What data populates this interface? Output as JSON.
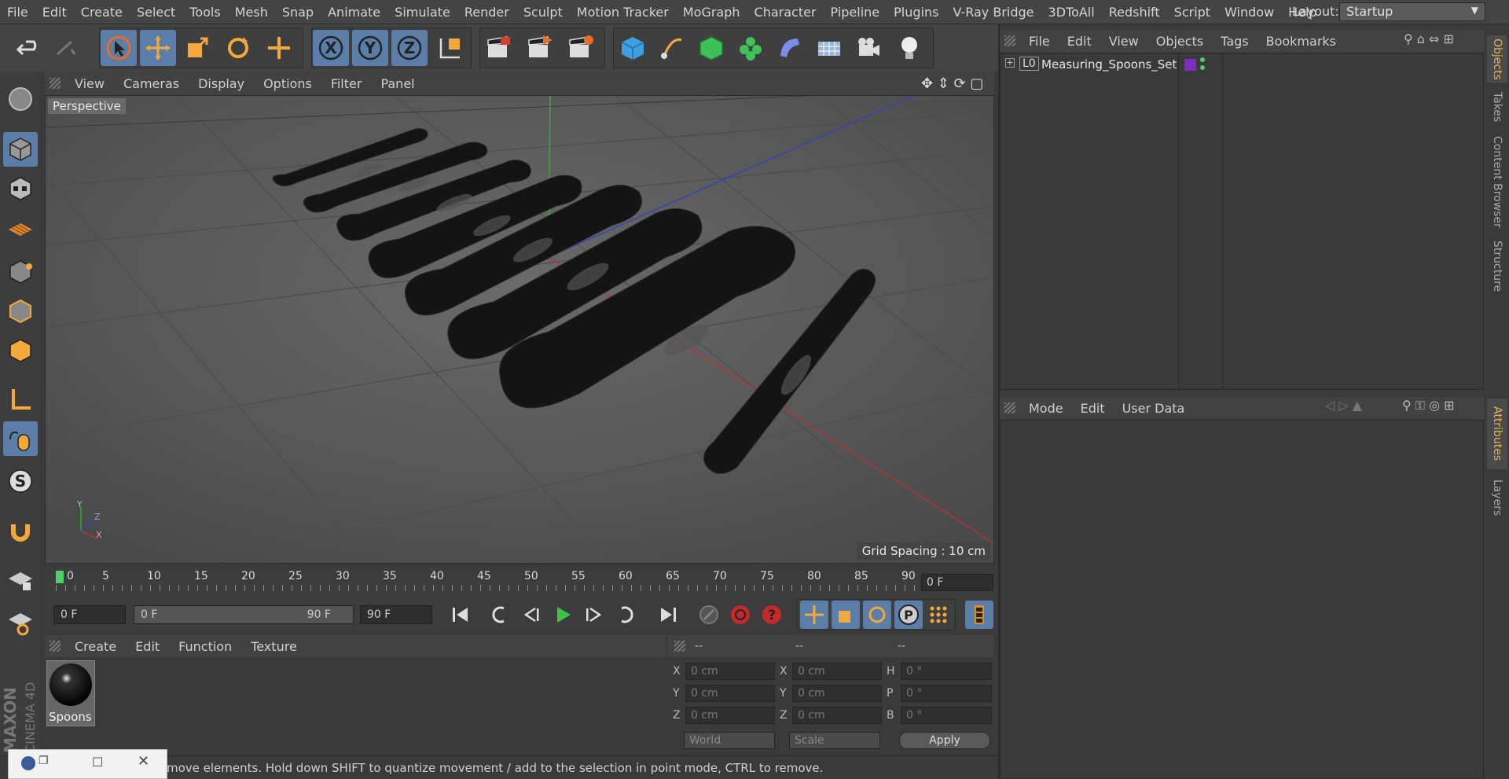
{
  "menubar": {
    "items": [
      "File",
      "Edit",
      "Create",
      "Select",
      "Tools",
      "Mesh",
      "Snap",
      "Animate",
      "Simulate",
      "Render",
      "Sculpt",
      "Motion Tracker",
      "MoGraph",
      "Character",
      "Pipeline",
      "Plugins",
      "V-Ray Bridge",
      "3DToAll",
      "Redshift",
      "Script",
      "Window",
      "Help"
    ],
    "layout_label": "Layout:",
    "layout_value": "Startup"
  },
  "viewport": {
    "menu": [
      "View",
      "Cameras",
      "Display",
      "Options",
      "Filter",
      "Panel"
    ],
    "camera_label": "Perspective",
    "grid_spacing": "Grid Spacing : 10 cm",
    "axis_labels": {
      "y": "Y",
      "z": "Z",
      "x": "X"
    }
  },
  "timeline": {
    "ticks": [
      "0",
      "5",
      "10",
      "15",
      "20",
      "25",
      "30",
      "35",
      "40",
      "45",
      "50",
      "55",
      "60",
      "65",
      "70",
      "75",
      "80",
      "85",
      "90"
    ],
    "current_frame": "0 F"
  },
  "transport": {
    "start_frame": "0 F",
    "range_start": "0 F",
    "range_end": "90 F",
    "end_frame": "90 F"
  },
  "material_manager": {
    "menu": [
      "Create",
      "Edit",
      "Function",
      "Texture"
    ],
    "material_name": "Spoons"
  },
  "coordinates": {
    "headers": [
      "--",
      "--",
      "--"
    ],
    "pos": [
      {
        "axis": "X",
        "value": "0 cm"
      },
      {
        "axis": "Y",
        "value": "0 cm"
      },
      {
        "axis": "Z",
        "value": "0 cm"
      }
    ],
    "size": [
      {
        "axis": "X",
        "value": "0 cm"
      },
      {
        "axis": "Y",
        "value": "0 cm"
      },
      {
        "axis": "Z",
        "value": "0 cm"
      }
    ],
    "rot": [
      {
        "axis": "H",
        "value": "0 °"
      },
      {
        "axis": "P",
        "value": "0 °"
      },
      {
        "axis": "B",
        "value": "0 °"
      }
    ],
    "mode_select": "World",
    "scale_select": "Scale",
    "apply_label": "Apply"
  },
  "object_manager": {
    "menu": [
      "File",
      "Edit",
      "View",
      "Objects",
      "Tags",
      "Bookmarks"
    ],
    "object_name": "Measuring_Spoons_Set",
    "tag_color": "#7b2fbf"
  },
  "attributes": {
    "menu": [
      "Mode",
      "Edit",
      "User Data"
    ]
  },
  "right_tabs": [
    "Objects",
    "Takes",
    "Content Browser",
    "Structure",
    "Attributes",
    "Layers"
  ],
  "status": {
    "text": "move elements. Hold down SHIFT to quantize movement / add to the selection in point mode, CTRL to remove."
  },
  "brand": {
    "line1": "MAXON",
    "line2": "CINEMA 4D"
  },
  "colors": {
    "accent": "#5a7ea8",
    "active_tab": "#e2b35a",
    "play": "#3fc24a"
  }
}
